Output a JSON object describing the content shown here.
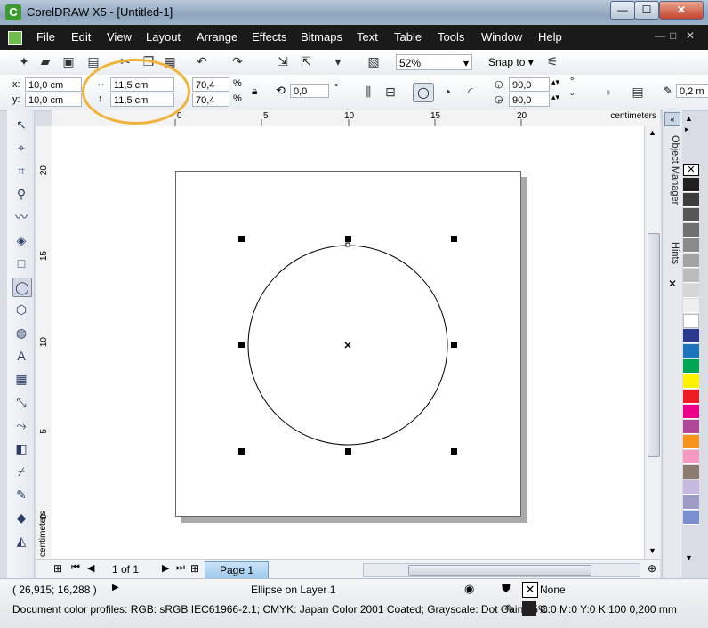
{
  "window": {
    "title": "CorelDRAW X5 - [Untitled-1]",
    "app_glyph": "C",
    "min": "—",
    "max": "☐",
    "close": "✕"
  },
  "menu": {
    "items": [
      "File",
      "Edit",
      "View",
      "Layout",
      "Arrange",
      "Effects",
      "Bitmaps",
      "Text",
      "Table",
      "Tools",
      "Window",
      "Help"
    ],
    "mdi_min": "—",
    "mdi_restore": "□",
    "mdi_close": "✕"
  },
  "standard_toolbar": {
    "zoom": "52%",
    "snap_to": "Snap to"
  },
  "property_bar": {
    "x_label": "x:",
    "x": "10,0 cm",
    "y_label": "y:",
    "y": "10,0 cm",
    "width": "11,5 cm",
    "height": "11,5 cm",
    "scale_w": "70,4",
    "scale_h": "70,4",
    "pct": "%",
    "rotation": "0,0",
    "degree": "°",
    "start_angle": "90,0",
    "end_angle": "90,0",
    "outline_width": "0,2 m"
  },
  "rulers": {
    "unit": "centimeters",
    "h_labels": [
      "0",
      "5",
      "10",
      "15",
      "20"
    ],
    "v_labels": [
      "20",
      "15",
      "10",
      "5",
      "0"
    ]
  },
  "dockers": {
    "object_manager": "Object Manager",
    "hints": "Hints"
  },
  "page_nav": {
    "page_count": "1 of 1",
    "page_tab": "Page 1"
  },
  "status": {
    "coords": "( 26,915; 16,288 )",
    "selection": "Ellipse on Layer 1",
    "fill": "None",
    "outline": "C:0 M:0 Y:0 K:100  0,200 mm",
    "profiles": "Document color profiles: RGB: sRGB IEC61966-2.1; CMYK: Japan Color 2001 Coated; Grayscale: Dot Gain 15%"
  },
  "palette": [
    "#231f20",
    "#3d3b3c",
    "#575556",
    "#707070",
    "#8a8a8a",
    "#a3a3a3",
    "#bcbcbc",
    "#d6d6d6",
    "#efefef",
    "#ffffff",
    "#2b3990",
    "#1c75bc",
    "#00a651",
    "#fff200",
    "#ed1c24",
    "#ec008c",
    "#b0479a",
    "#f7941d",
    "#f49ac1",
    "#8c7b70",
    "#c7b8e0",
    "#9e9ac8",
    "#7b8ed1"
  ],
  "colors": {
    "accent_annotation": "#f0b33a",
    "page_tab": "#9fc9ec"
  }
}
